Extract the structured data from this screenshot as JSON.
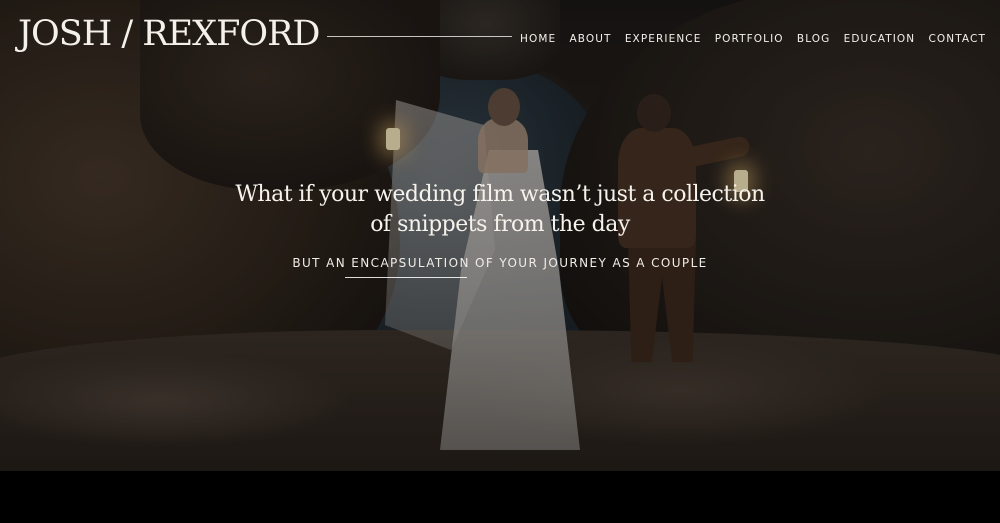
{
  "header": {
    "logo_text": "JOSH / REXFORD",
    "nav": [
      {
        "label": "HOME"
      },
      {
        "label": "ABOUT"
      },
      {
        "label": "EXPERIENCE"
      },
      {
        "label": "PORTFOLIO"
      },
      {
        "label": "BLOG"
      },
      {
        "label": "EDUCATION"
      },
      {
        "label": "CONTACT"
      }
    ]
  },
  "hero": {
    "headline": "What if your wedding film wasn’t just a collection of snippets from the day",
    "subline": "BUT AN ENCAPSULATION OF YOUR JOURNEY AS A COUPLE"
  },
  "colors": {
    "text": "#f4f0ea",
    "background": "#000000"
  }
}
